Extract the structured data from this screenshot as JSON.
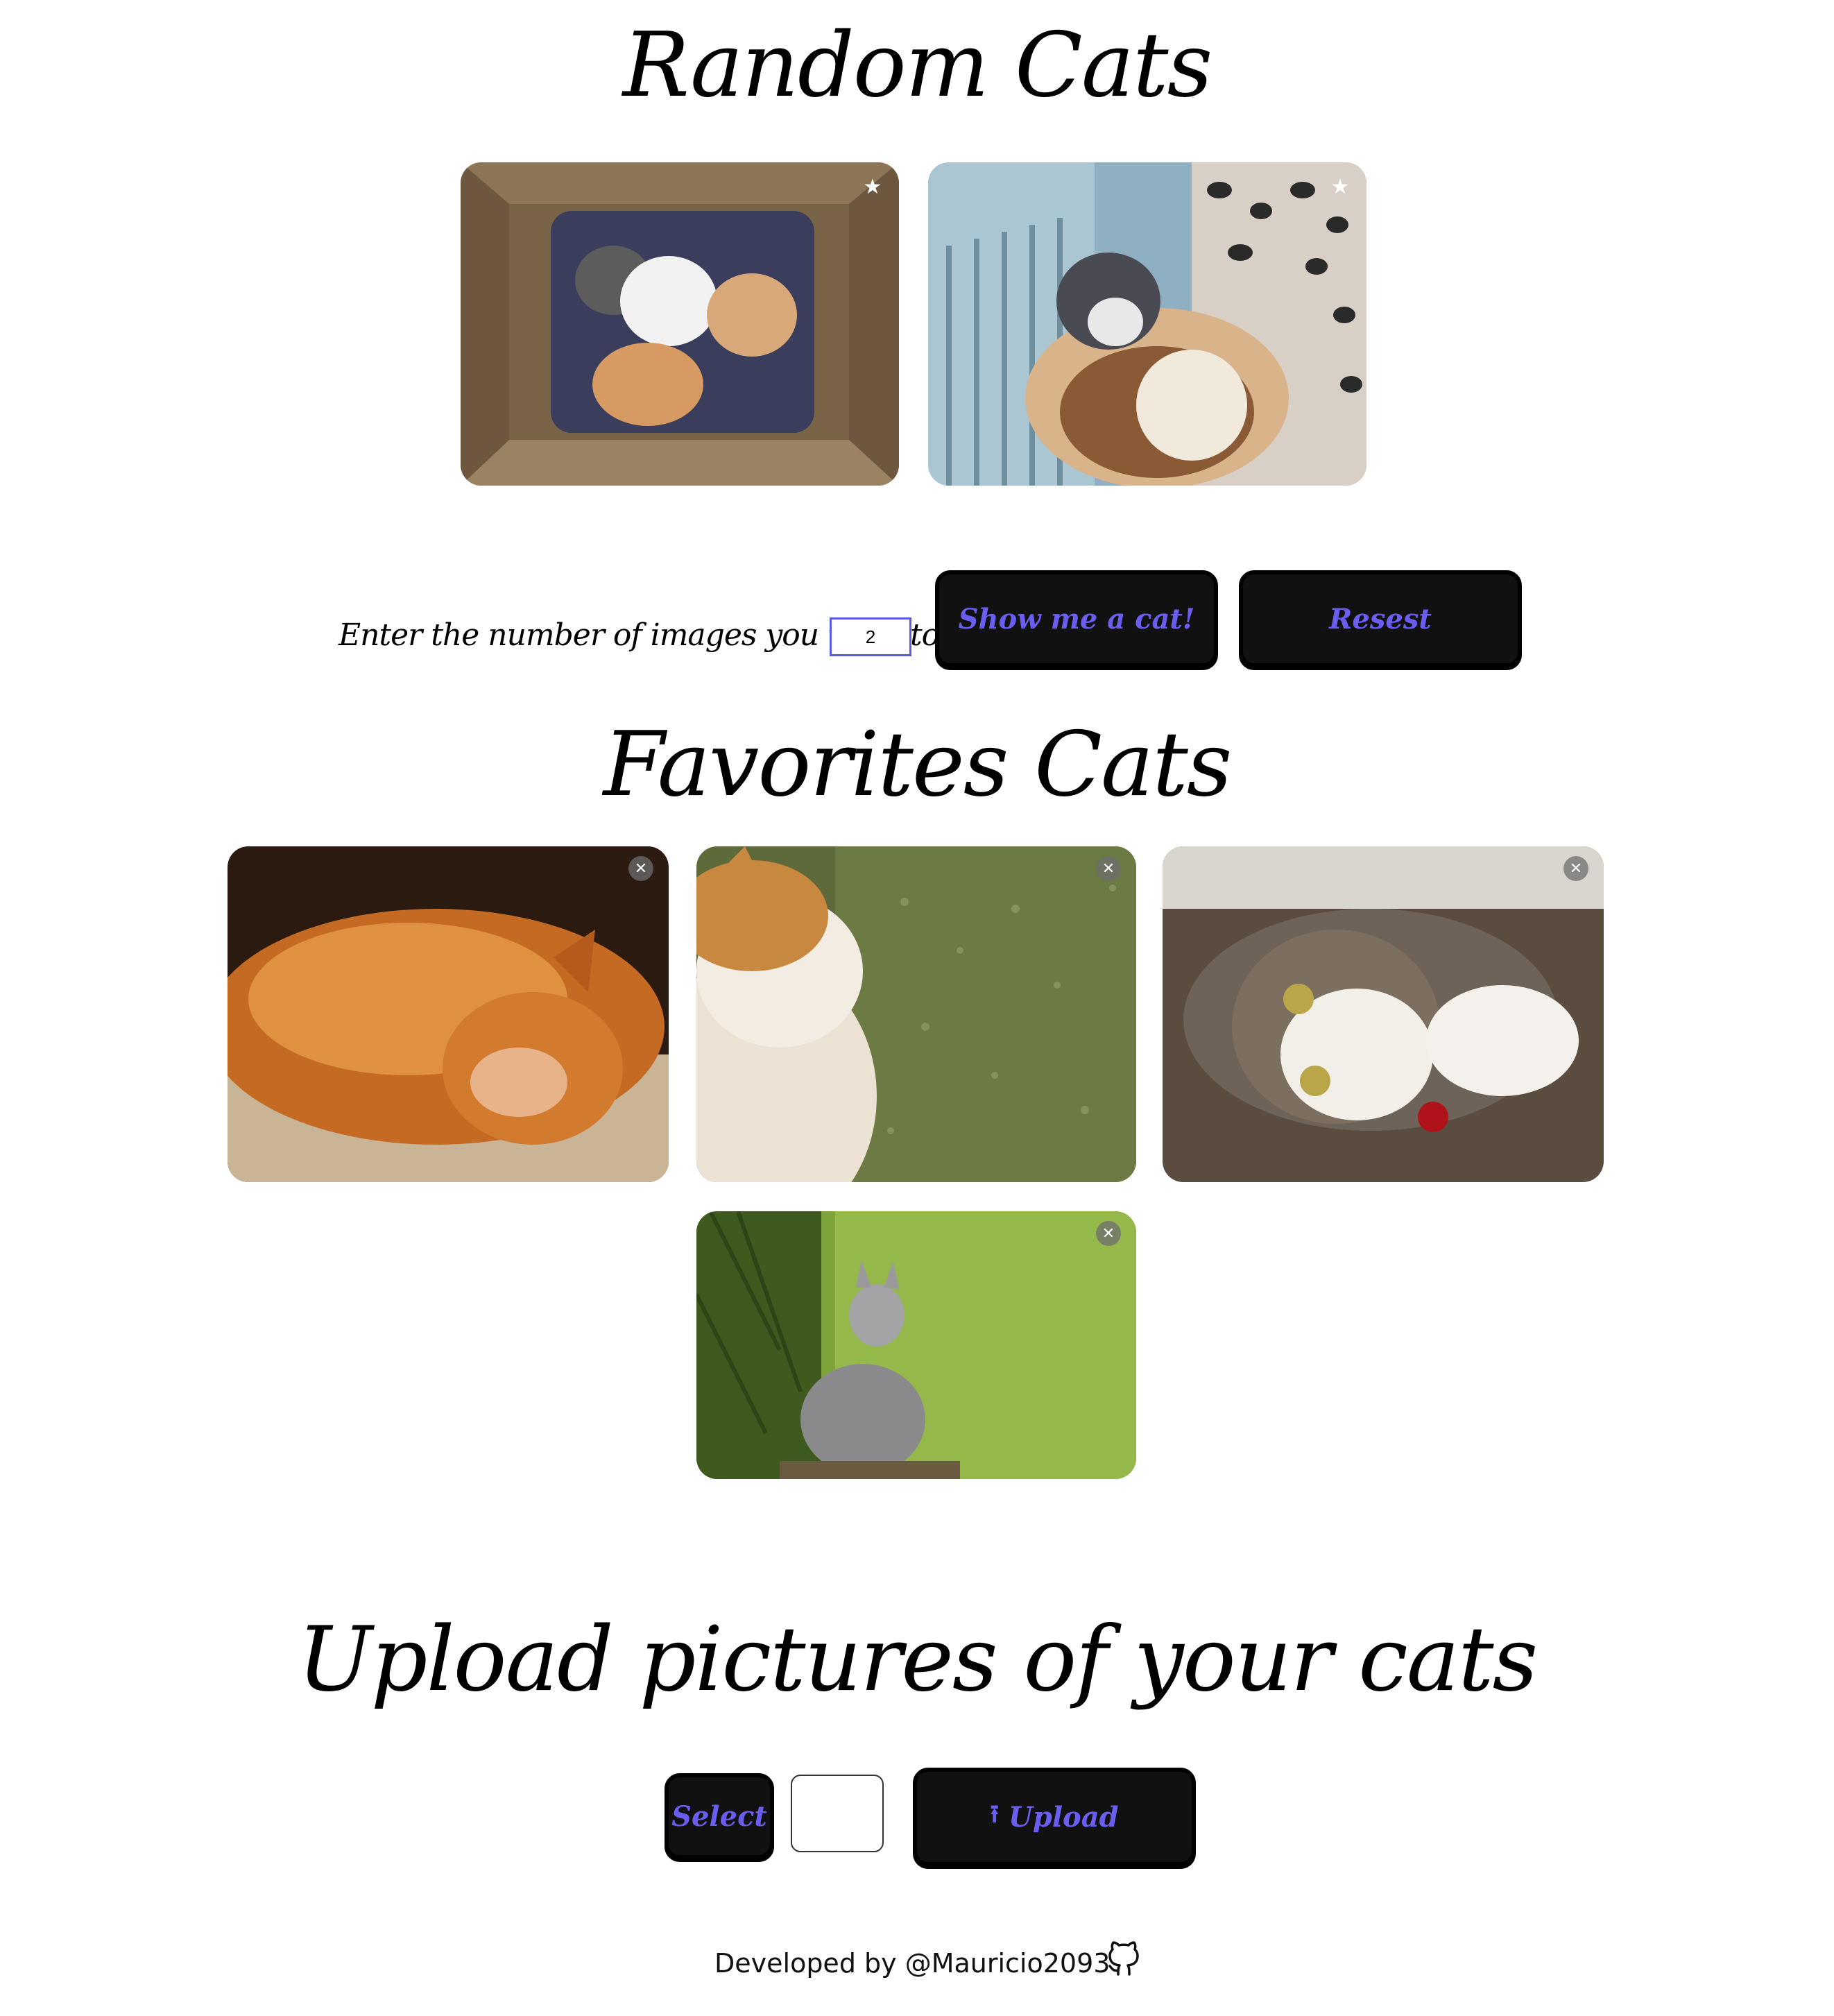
{
  "random_section": {
    "title": "Random Cats",
    "cards": [
      {
        "alt": "kittens in a box",
        "action_icon": "star-icon",
        "action_glyph": "★"
      },
      {
        "alt": "kitten in baseball glove",
        "action_icon": "star-icon",
        "action_glyph": "★"
      }
    ]
  },
  "controls": {
    "label": "Enter the number of images you want to see",
    "count_value": "2",
    "show_button": "Show me a cat!",
    "reset_button": "Resest"
  },
  "favorites_section": {
    "title": "Favorites Cats",
    "cards": [
      {
        "alt": "sleeping orange cat",
        "action_icon": "close-icon",
        "action_glyph": "✕"
      },
      {
        "alt": "cat looking at rainy window",
        "action_icon": "close-icon",
        "action_glyph": "✕"
      },
      {
        "alt": "tabby cat lying on rug",
        "action_icon": "close-icon",
        "action_glyph": "✕"
      },
      {
        "alt": "grey kitten in grass",
        "action_icon": "close-icon",
        "action_glyph": "✕"
      }
    ]
  },
  "upload_section": {
    "title": "Upload pictures of your cats",
    "select_button": "Select",
    "upload_button": "Upload",
    "upload_icon": "upload-arrow-icon"
  },
  "footer": {
    "text": "Developed by @Mauricio2093",
    "icon": "github-icon"
  },
  "colors": {
    "button_bg": "#111111",
    "button_text": "#6a5ef0",
    "input_border": "#5b5be0"
  }
}
